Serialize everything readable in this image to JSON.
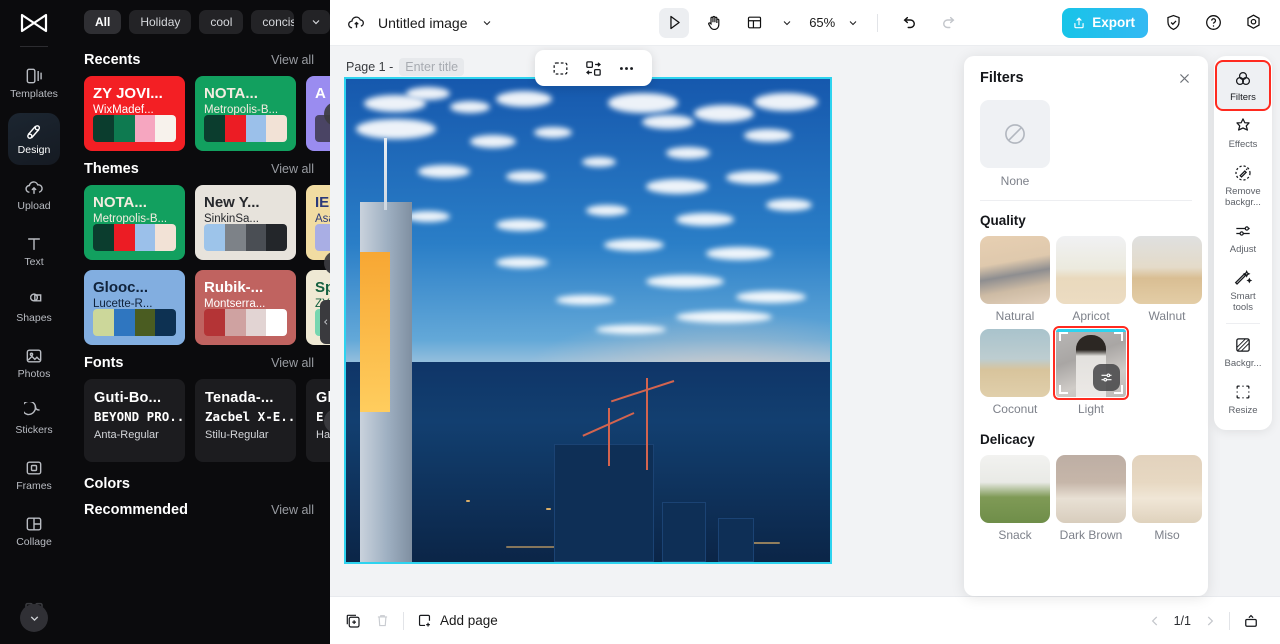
{
  "app": {
    "logo": "capcut-logo"
  },
  "rail": {
    "items": [
      {
        "label": "Templates",
        "icon": "templates-icon",
        "active": false
      },
      {
        "label": "Design",
        "icon": "design-icon",
        "active": true
      },
      {
        "label": "Upload",
        "icon": "upload-icon",
        "active": false
      },
      {
        "label": "Text",
        "icon": "text-icon",
        "active": false
      },
      {
        "label": "Shapes",
        "icon": "shapes-icon",
        "active": false
      },
      {
        "label": "Photos",
        "icon": "photos-icon",
        "active": false
      },
      {
        "label": "Stickers",
        "icon": "stickers-icon",
        "active": false
      },
      {
        "label": "Frames",
        "icon": "frames-icon",
        "active": false
      },
      {
        "label": "Collage",
        "icon": "collage-icon",
        "active": false
      }
    ],
    "more": "chevron-down-icon"
  },
  "panel": {
    "chips": [
      "All",
      "Holiday",
      "cool",
      "concise"
    ],
    "chips_more": "chevron-down-icon",
    "sections": {
      "recents": {
        "title": "Recents",
        "view_all": "View all"
      },
      "themes": {
        "title": "Themes",
        "view_all": "View all"
      },
      "fonts": {
        "title": "Fonts",
        "view_all": "View all"
      },
      "colors": {
        "title": "Colors",
        "recommended": "Recommended",
        "view_all": "View all"
      }
    },
    "recents": [
      {
        "t1": "ZY JOVI...",
        "t2": "WixMadef...",
        "bg": "#f31f24",
        "fg": "#ffffff",
        "swatches": [
          "#0b3d2e",
          "#0e7a50",
          "#f6a6c0",
          "#f7f2ec"
        ]
      },
      {
        "t1": "NOTA...",
        "t2": "Metropolis-B...",
        "bg": "#12a05f",
        "fg": "#f4ece0",
        "swatches": [
          "#0b3d2e",
          "#ec1c24",
          "#9bc0ea",
          "#f2e2d6"
        ]
      },
      {
        "t1": "A",
        "t2": "",
        "bg": "#9a8cf0",
        "fg": "#ffffff",
        "swatches": [
          "#4a4464",
          "#4a4464",
          "#4a4464",
          "#4a4464"
        ]
      }
    ],
    "themes": [
      {
        "t1": "NOTA...",
        "t2": "Metropolis-B...",
        "bg": "#12a05f",
        "fg": "#f4ece0",
        "swatches": [
          "#0b3d2e",
          "#ec1c24",
          "#9bc0ea",
          "#f2e2d6"
        ]
      },
      {
        "t1": "New Y...",
        "t2": "SinkinSa...",
        "bg": "#e7e3dc",
        "fg": "#27292d",
        "swatches": [
          "#9dc4ea",
          "#7d8288",
          "#4a4e54",
          "#23262a"
        ]
      },
      {
        "t1": "IE",
        "t2": "Asa",
        "bg": "#f1dca2",
        "fg": "#2b3a7a",
        "swatches": [
          "#a9aee4",
          "#a9aee4",
          "#a9aee4",
          "#a9aee4"
        ]
      },
      {
        "t1": "Glooc...",
        "t2": "Lucette-R...",
        "bg": "#82aee0",
        "fg": "#10233c",
        "swatches": [
          "#ccd79a",
          "#2f76c0",
          "#4a5c21",
          "#0d3152"
        ]
      },
      {
        "t1": "Rubik-...",
        "t2": "Montserra...",
        "bg": "#c06360",
        "fg": "#ffffff",
        "swatches": [
          "#b43436",
          "#cfa2a1",
          "#e2d4d3",
          "#ffffff"
        ]
      },
      {
        "t1": "Sp",
        "t2": "ZY",
        "bg": "#efe9d4",
        "fg": "#14603f",
        "swatches": [
          "#76d6b0",
          "#76d6b0",
          "#76d6b0",
          "#76d6b0"
        ]
      }
    ],
    "fonts": [
      {
        "f1": "Guti-Bo...",
        "f2": "BEYOND PRO...",
        "f3": "Anta-Regular"
      },
      {
        "f1": "Tenada-...",
        "f2": "Zacbel X-E...",
        "f3": "Stilu-Regular"
      },
      {
        "f1": "Gl",
        "f2": "E",
        "f3": "Hami"
      }
    ]
  },
  "topbar": {
    "cloud_icon": "cloud-upload-icon",
    "title": "Untitled image",
    "title_caret": "chevron-down-icon",
    "tools": [
      {
        "name": "select-tool",
        "icon": "cursor-icon",
        "active": true
      },
      {
        "name": "hand-tool",
        "icon": "hand-icon",
        "active": false
      },
      {
        "name": "layout-tool",
        "icon": "layout-icon",
        "active": false
      }
    ],
    "zoom": "65%",
    "zoom_caret": "chevron-down-icon",
    "undo": "undo-icon",
    "redo": "redo-icon",
    "export_label": "Export",
    "export_icon": "share-icon",
    "shield": "shield-check-icon",
    "help": "question-circle-icon",
    "settings": "gear-icon"
  },
  "canvas": {
    "page_label": "Page 1 -",
    "title_placeholder": "Enter title",
    "floatbar": [
      {
        "name": "cutout-icon"
      },
      {
        "name": "replace-icon"
      },
      {
        "name": "more-horizontal-icon"
      }
    ],
    "duplicate_icon": "duplicate-image-icon",
    "more_icon": "more-horizontal-icon",
    "image_alt": "city-skyline-photo"
  },
  "bottombar": {
    "duplicate_page_icon": "duplicate-page-icon",
    "delete_icon": "trash-icon",
    "add_page_label": "Add page",
    "add_page_icon": "add-page-icon",
    "prev_icon": "chevron-left-icon",
    "page_indicator": "1/1",
    "next_icon": "chevron-right-icon",
    "present_icon": "present-icon"
  },
  "filters": {
    "title": "Filters",
    "close_icon": "close-icon",
    "none": {
      "label": "None",
      "icon": "no-filter-icon"
    },
    "groups": [
      {
        "title": "Quality",
        "items": [
          {
            "label": "Natural",
            "selected": false,
            "thumb": "room-interior"
          },
          {
            "label": "Apricot",
            "selected": false,
            "thumb": "desert-pale"
          },
          {
            "label": "Walnut",
            "selected": false,
            "thumb": "desert-warm"
          },
          {
            "label": "Coconut",
            "selected": false,
            "thumb": "desert-cool"
          },
          {
            "label": "Light",
            "selected": true,
            "thumb": "portrait-woman"
          }
        ]
      },
      {
        "title": "Delicacy",
        "items": [
          {
            "label": "Snack",
            "selected": false,
            "thumb": "plate-pasta"
          },
          {
            "label": "Dark Brown",
            "selected": false,
            "thumb": "cake-dark"
          },
          {
            "label": "Miso",
            "selected": false,
            "thumb": "cake-warm"
          }
        ]
      }
    ],
    "selected_badge_icon": "adjust-sliders-icon"
  },
  "toolrail": {
    "items": [
      {
        "label": "Filters",
        "icon": "filters-icon",
        "active": true,
        "highlight": true
      },
      {
        "label": "Effects",
        "icon": "effects-icon",
        "active": false,
        "highlight": false
      },
      {
        "label": "Remove backgr...",
        "icon": "remove-background-icon",
        "active": false,
        "highlight": false
      },
      {
        "label": "Adjust",
        "icon": "adjust-icon",
        "active": false,
        "highlight": false
      },
      {
        "label": "Smart tools",
        "icon": "smart-tools-icon",
        "active": false,
        "highlight": false
      },
      {
        "label": "Backgr...",
        "icon": "background-icon",
        "active": false,
        "highlight": false
      },
      {
        "label": "Resize",
        "icon": "resize-icon",
        "active": false,
        "highlight": false
      }
    ]
  },
  "colors": {
    "accent": "#2ed3ef",
    "selection_red": "#ff2a1f",
    "export_blue": "#17c4e8"
  }
}
